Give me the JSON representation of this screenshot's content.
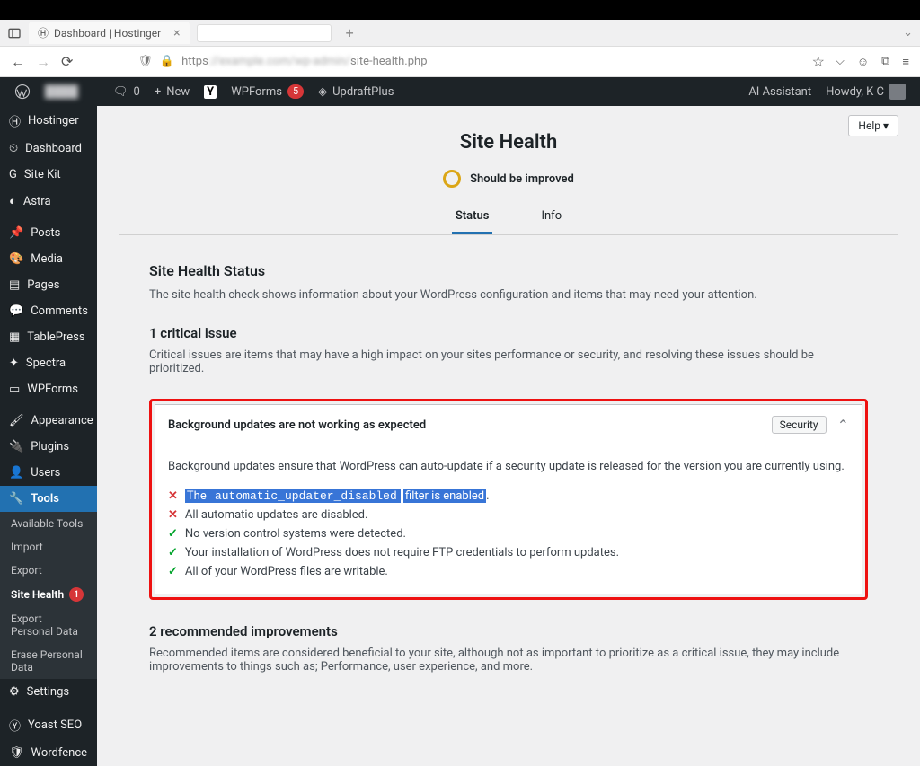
{
  "browser": {
    "tab_title": "Dashboard | Hostinger",
    "url_prefix": "https",
    "url_suffix": "site-health.php"
  },
  "adminbar": {
    "comments_count": "0",
    "new_label": "New",
    "wpforms_label": "WPForms",
    "wpforms_count": "5",
    "updraft_label": "UpdraftPlus",
    "ai_assistant": "AI Assistant",
    "howdy": "Howdy, K C"
  },
  "sidebar": {
    "items": [
      {
        "label": "Hostinger",
        "icon": "hostinger"
      },
      {
        "label": "Dashboard",
        "icon": "dashboard"
      },
      {
        "label": "Site Kit",
        "icon": "g"
      },
      {
        "label": "Astra",
        "icon": "astra"
      }
    ],
    "items2": [
      {
        "label": "Posts",
        "icon": "pin"
      },
      {
        "label": "Media",
        "icon": "media"
      },
      {
        "label": "Pages",
        "icon": "pages"
      },
      {
        "label": "Comments",
        "icon": "comments"
      },
      {
        "label": "TablePress",
        "icon": "table"
      },
      {
        "label": "Spectra",
        "icon": "spectra"
      },
      {
        "label": "WPForms",
        "icon": "forms"
      }
    ],
    "items3": [
      {
        "label": "Appearance",
        "icon": "brush"
      },
      {
        "label": "Plugins",
        "icon": "plug"
      },
      {
        "label": "Users",
        "icon": "users"
      },
      {
        "label": "Tools",
        "icon": "wrench",
        "active": true
      }
    ],
    "submenu": [
      {
        "label": "Available Tools"
      },
      {
        "label": "Import"
      },
      {
        "label": "Export"
      },
      {
        "label": "Site Health",
        "current": true,
        "badge": "1"
      },
      {
        "label": "Export Personal Data"
      },
      {
        "label": "Erase Personal Data"
      }
    ],
    "items4": [
      {
        "label": "Settings",
        "icon": "settings"
      }
    ],
    "items5": [
      {
        "label": "Yoast SEO",
        "icon": "yoast"
      },
      {
        "label": "Wordfence",
        "icon": "shield"
      }
    ]
  },
  "content": {
    "help_label": "Help",
    "page_title": "Site Health",
    "status_label": "Should be improved",
    "tabs": {
      "status": "Status",
      "info": "Info"
    },
    "status_heading": "Site Health Status",
    "status_desc": "The site health check shows information about your WordPress configuration and items that may need your attention.",
    "critical_heading": "1 critical issue",
    "critical_desc": "Critical issues are items that may have a high impact on your sites performance or security, and resolving these issues should be prioritized.",
    "card": {
      "title": "Background updates are not working as expected",
      "category": "Security",
      "body_intro": "Background updates ensure that WordPress can auto-update if a security update is released for the version you are currently using.",
      "items": [
        {
          "ok": false,
          "pre": "The ",
          "code": "automatic_updater_disabled",
          "post": " filter is enabled",
          "highlighted": true
        },
        {
          "ok": false,
          "text": "All automatic updates are disabled."
        },
        {
          "ok": true,
          "text": "No version control systems were detected."
        },
        {
          "ok": true,
          "text": "Your installation of WordPress does not require FTP credentials to perform updates."
        },
        {
          "ok": true,
          "text": "All of your WordPress files are writable."
        }
      ]
    },
    "recommended_heading": "2 recommended improvements",
    "recommended_desc": "Recommended items are considered beneficial to your site, although not as important to prioritize as a critical issue, they may include improvements to things such as; Performance, user experience, and more."
  }
}
